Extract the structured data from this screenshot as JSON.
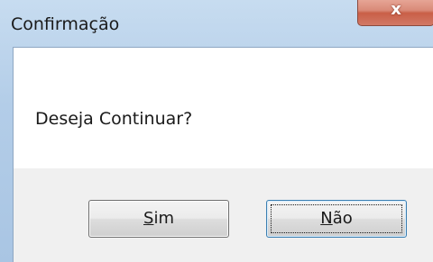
{
  "window": {
    "title": "Confirmação",
    "close_glyph": "x"
  },
  "dialog": {
    "message": "Deseja Continuar?"
  },
  "buttons": {
    "yes": {
      "mnemonic": "S",
      "rest": "im"
    },
    "no": {
      "mnemonic": "N",
      "rest": "ão"
    }
  },
  "colors": {
    "frame": "#b3cde8",
    "close_button": "#c95f47",
    "focused_button_border": "#3c7fb1"
  }
}
